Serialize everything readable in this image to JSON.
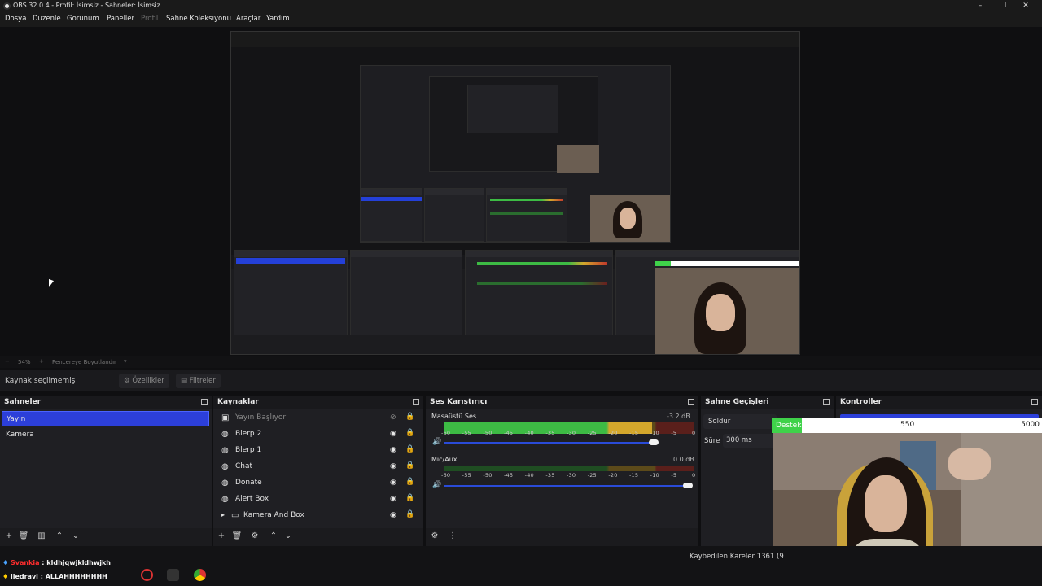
{
  "window": {
    "title": "OBS 32.0.4 - Profil: İsimsiz - Sahneler: İsimsiz"
  },
  "menu": [
    "Dosya",
    "Düzenle",
    "Görünüm",
    "Paneller",
    "Profil",
    "Sahne Koleksiyonu",
    "Araçlar",
    "Yardım"
  ],
  "zoom": {
    "percent": "54%",
    "mode": "Pencereye Boyutlandır"
  },
  "source_toolbar": {
    "no_selection": "Kaynak seçilmemiş",
    "properties": "Özellikler",
    "filters": "Filtreler"
  },
  "scenes": {
    "title": "Sahneler",
    "items": [
      "Yayın",
      "Kamera"
    ],
    "selected": "Yayın"
  },
  "sources": {
    "title": "Kaynaklar",
    "items": [
      {
        "name": "Yayın Başlıyor",
        "icon": "image-icon",
        "visible": false
      },
      {
        "name": "Blerp 2",
        "icon": "globe-icon",
        "visible": true
      },
      {
        "name": "Blerp 1",
        "icon": "globe-icon",
        "visible": true
      },
      {
        "name": "Chat",
        "icon": "globe-icon",
        "visible": true
      },
      {
        "name": "Donate",
        "icon": "globe-icon",
        "visible": true
      },
      {
        "name": "Alert Box",
        "icon": "globe-icon",
        "visible": true
      },
      {
        "name": "Kamera And Box",
        "icon": "folder-icon",
        "visible": true
      }
    ]
  },
  "mixer": {
    "title": "Ses Karıştırıcı",
    "channels": [
      {
        "name": "Masaüstü Ses",
        "db": "-3.2 dB",
        "level": 0.83,
        "volume": 0.86
      },
      {
        "name": "Mic/Aux",
        "db": "0.0 dB",
        "level": 0.0,
        "volume": 1.0
      }
    ],
    "ticks": [
      "-60",
      "-55",
      "-50",
      "-45",
      "-40",
      "-35",
      "-30",
      "-25",
      "-20",
      "-15",
      "-10",
      "-5",
      "0"
    ]
  },
  "transitions": {
    "title": "Sahne Geçişleri",
    "selected": "Soldur",
    "duration_label": "Süre",
    "duration_value": "300 ms"
  },
  "controls": {
    "title": "Kontroller"
  },
  "donation": {
    "label": "Destek",
    "current": "550",
    "goal": "5000",
    "progress": 0.11
  },
  "status": {
    "dropped_frames": "Kaybedilen Kareler 1361 (9"
  },
  "chat": [
    {
      "user": "Svankia",
      "message": "kldhjqwjkldhwjkh"
    },
    {
      "user": "liedravl",
      "message": "ALLAHHHHHHHH"
    }
  ],
  "colors": {
    "accent": "#2c3fd9",
    "meter_green": "#3dbb44",
    "meter_yellow": "#d4a72c",
    "meter_red": "#c0392b",
    "donation_green": "#3fd24a"
  }
}
